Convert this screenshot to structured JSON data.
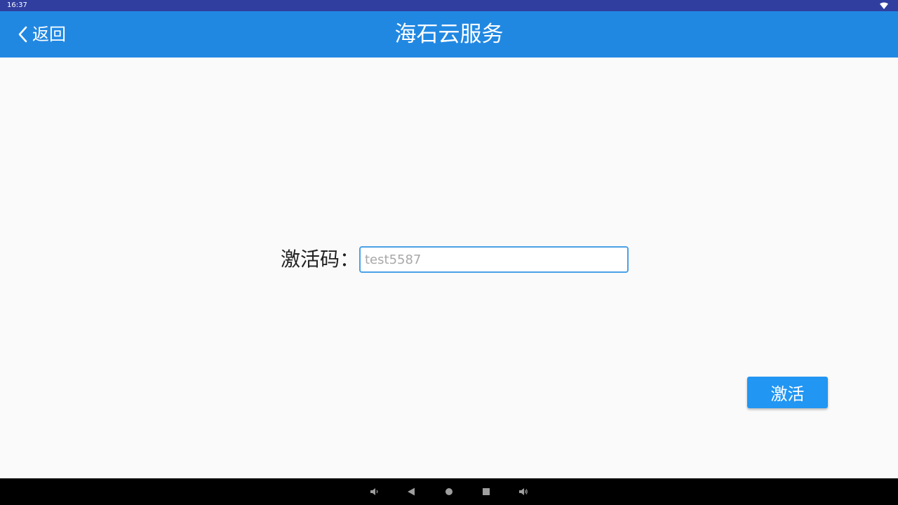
{
  "status_bar": {
    "time": "16:37",
    "icons": [
      "wifi-icon"
    ]
  },
  "app_bar": {
    "back_label": "返回",
    "title": "海石云服务",
    "color": "#2188e2"
  },
  "form": {
    "code_label": "激活码：",
    "code_input": {
      "value": "",
      "placeholder": "test5587"
    },
    "activate_label": "激活",
    "accent_color": "#2196f3"
  },
  "nav_bar": {
    "buttons": [
      "volume-down-icon",
      "back-triangle-icon",
      "home-circle-icon",
      "recents-square-icon",
      "volume-up-icon"
    ]
  }
}
